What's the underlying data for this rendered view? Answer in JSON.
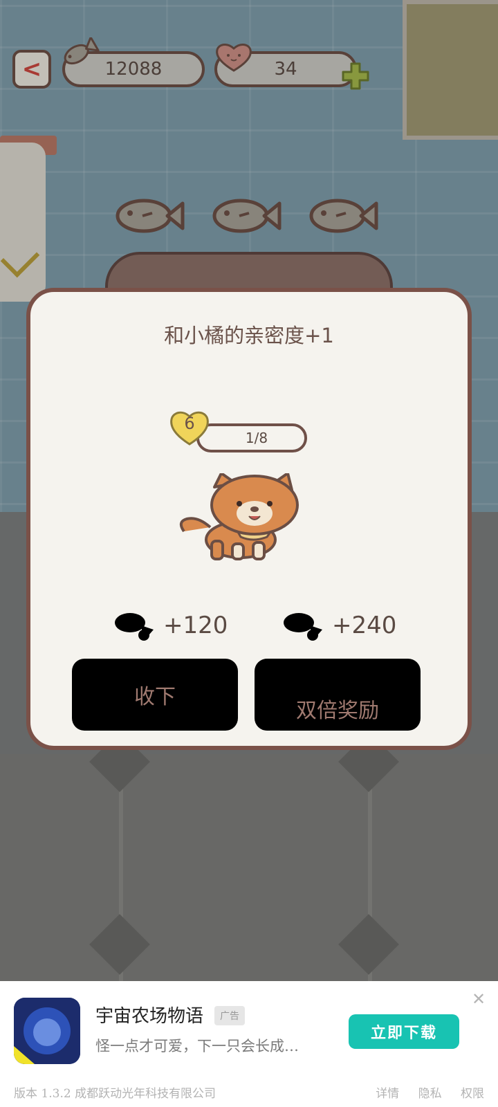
{
  "hud": {
    "back_label": "<",
    "fish_count": "12088",
    "heart_count": "34"
  },
  "dialog": {
    "title": "和小橘的亲密度+1",
    "level": "6",
    "progress_text": "1/8",
    "progress_fraction": 0.125,
    "reward_normal": "+120",
    "reward_double": "+240",
    "collect_label": "收下",
    "double_label": "双倍奖励"
  },
  "ad": {
    "title": "宇宙农场物语",
    "tag": "广告",
    "subtitle": "怪一点才可爱，下一只会长成…",
    "download_label": "立即下载",
    "close_label": "✕",
    "footer_left": "版本 1.3.2   成都跃动光年科技有限公司",
    "link_details": "详情",
    "link_privacy": "隐私",
    "link_permissions": "权限"
  },
  "colors": {
    "dialog_border": "#7a5148",
    "ad_button": "#18c3b2",
    "back_arrow": "#c9463e"
  }
}
